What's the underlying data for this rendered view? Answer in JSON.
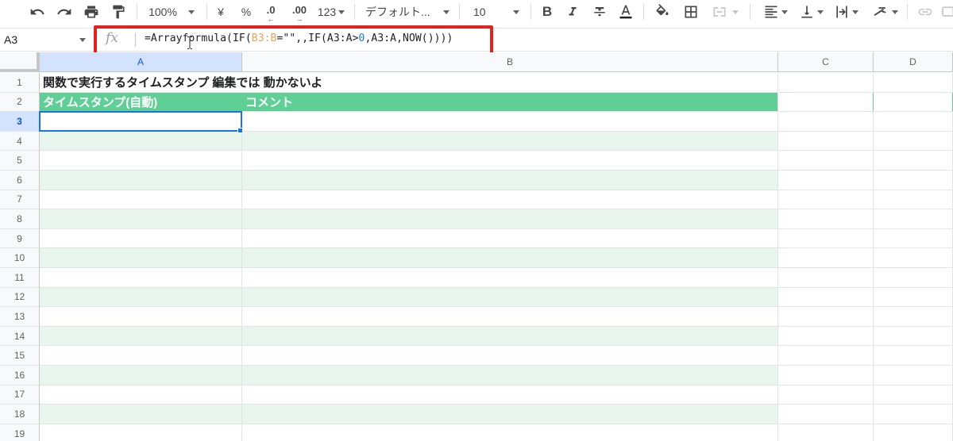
{
  "toolbar": {
    "zoom": "100%",
    "currency": "¥",
    "percent": "%",
    "decrease_decimals": ".0",
    "increase_decimals": ".00",
    "number_format": "123",
    "font": "デフォルト...",
    "font_size": "10",
    "bold": "B"
  },
  "formula_bar": {
    "name_box": "A3",
    "fx_label": "fx",
    "formula_parts": {
      "p1": "=Arrayformula(IF(",
      "p2": "B3:B",
      "p3": "=\"\",,IF(A3:A>",
      "p4": "0",
      "p5": ",A3:A,NOW())))"
    }
  },
  "columns": [
    "A",
    "B",
    "C",
    "D"
  ],
  "active_column": "A",
  "active_row": "3",
  "rows": [
    "1",
    "2",
    "3",
    "4",
    "5",
    "6",
    "7",
    "8",
    "9",
    "10",
    "11",
    "12",
    "13",
    "14",
    "15",
    "16",
    "17",
    "18",
    "19"
  ],
  "sheet": {
    "title": "関数で実行するタイムスタンプ  編集では 動かないよ",
    "header_a": "タイムスタンプ(自動)",
    "header_b": "コメント"
  },
  "colors": {
    "header_fill": "#5fcf95",
    "band_fill": "#e8f6ee",
    "selection": "#1a73e8",
    "highlight_box": "#e0231e"
  }
}
